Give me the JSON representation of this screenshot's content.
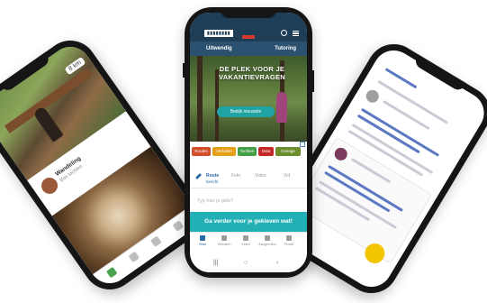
{
  "center_phone": {
    "nav": {
      "left": "Uitwendig",
      "right": "Tutoring"
    },
    "hero": {
      "title": "DE PLEK VOOR JE VAKANTIEVRAGEN",
      "button": "Bekijk nieuwste"
    },
    "chips": [
      {
        "label": "Routes",
        "color": "#d1502b"
      },
      {
        "label": "Verhalen",
        "color": "#e3a018"
      },
      {
        "label": "Tochten",
        "color": "#43a047"
      },
      {
        "label": "Data",
        "color": "#c62828"
      },
      {
        "label": "Overige",
        "color": "#6a8e2e"
      }
    ],
    "post_tabs": [
      {
        "label": "Route",
        "sublabel": "bericht",
        "active": true
      },
      {
        "label": "Foto",
        "active": false
      },
      {
        "label": "Video",
        "active": false
      },
      {
        "label": "Vid",
        "active": false
      }
    ],
    "input_placeholder": "Typ hier je gids?",
    "cta": "Ga verder voor je gekleven wat!",
    "tabbar": [
      {
        "label": "Start",
        "active": true
      },
      {
        "label": "Verhalen",
        "active": false
      },
      {
        "label": "Video",
        "active": false
      },
      {
        "label": "Aangemeld",
        "active": false
      },
      {
        "label": "Profiel",
        "active": false
      }
    ],
    "system_buttons": [
      "|||",
      "○",
      "‹"
    ]
  },
  "left_phone": {
    "badge": "8 km",
    "card_name": "Wandeling",
    "card_sub": "Bos tochten"
  }
}
